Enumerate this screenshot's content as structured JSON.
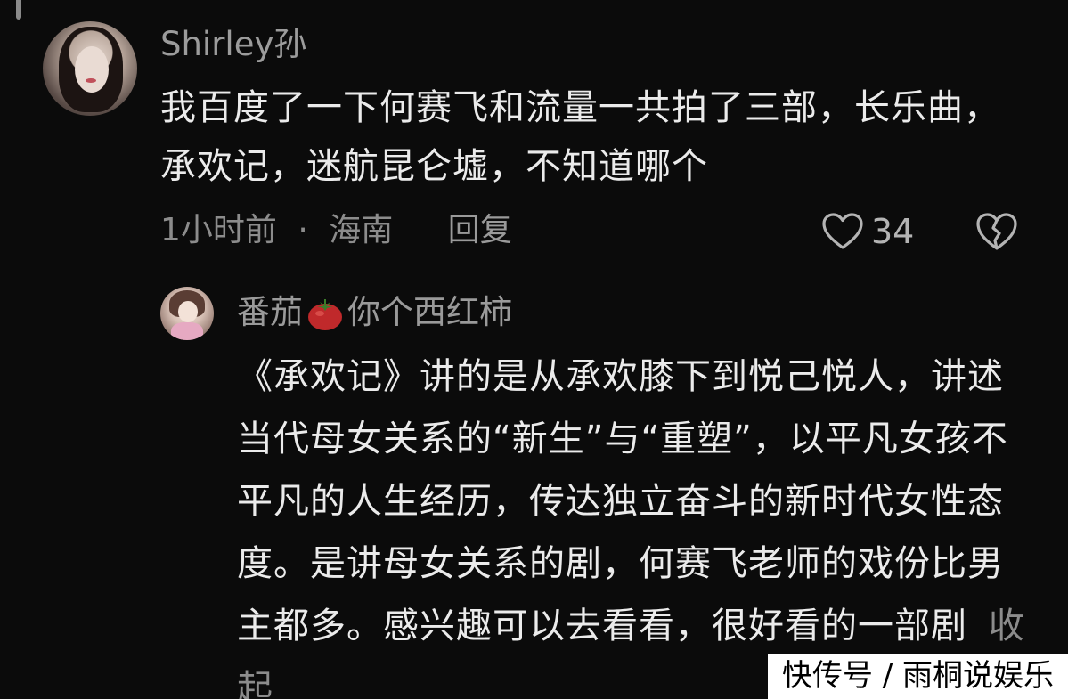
{
  "comment": {
    "username": "Shirley孙",
    "text": "我百度了一下何赛飞和流量一共拍了三部，长乐曲，承欢记，迷航昆仑墟，不知道哪个",
    "time": "1小时前",
    "separator": "·",
    "location": "海南",
    "reply_label": "回复",
    "like_count": "34"
  },
  "reply": {
    "username_prefix": "番茄",
    "username_suffix": "你个西红柿",
    "text": "《承欢记》讲的是从承欢膝下到悦己悦人，讲述当代母女关系的“新生”与“重塑”，以平凡女孩不平凡的人生经历，传达独立奋斗的新时代女性态度。是讲母女关系的剧，何赛飞老师的戏份比男主都多。感兴趣可以去看看，很好看的一部剧",
    "collapse_label": "收起"
  },
  "watermark": {
    "text": "快传号 / 雨桐说娱乐"
  },
  "icons": {
    "like": "heart-outline-icon",
    "dislike": "broken-heart-icon",
    "emoji": "tomato-icon"
  },
  "colors": {
    "background": "#0b0b0b",
    "text_primary": "#ebebeb",
    "text_secondary": "#9c9c9c"
  }
}
